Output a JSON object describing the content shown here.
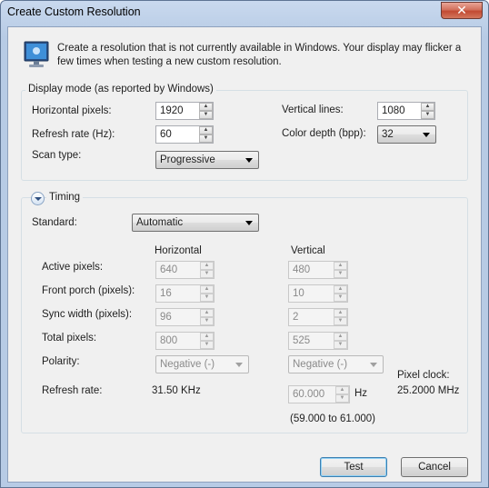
{
  "window": {
    "title": "Create Custom Resolution",
    "close_glyph": "✕"
  },
  "intro": {
    "icon": "monitor-icon",
    "text": "Create a resolution that is not currently available in Windows. Your display may flicker a few times when testing a new custom resolution."
  },
  "display_mode": {
    "legend": "Display mode (as reported by Windows)",
    "horizontal_pixels": {
      "label": "Horizontal pixels:",
      "value": "1920"
    },
    "vertical_lines": {
      "label": "Vertical lines:",
      "value": "1080"
    },
    "refresh_rate": {
      "label": "Refresh rate (Hz):",
      "value": "60"
    },
    "color_depth": {
      "label": "Color depth (bpp):",
      "value": "32"
    },
    "scan_type": {
      "label": "Scan type:",
      "value": "Progressive"
    }
  },
  "timing": {
    "legend": "Timing",
    "standard": {
      "label": "Standard:",
      "value": "Automatic"
    },
    "col_horizontal": "Horizontal",
    "col_vertical": "Vertical",
    "rows": [
      {
        "label": "Active pixels:",
        "h": "640",
        "v": "480"
      },
      {
        "label": "Front porch (pixels):",
        "h": "16",
        "v": "10"
      },
      {
        "label": "Sync width (pixels):",
        "h": "96",
        "v": "2"
      },
      {
        "label": "Total pixels:",
        "h": "800",
        "v": "525"
      }
    ],
    "polarity": {
      "label": "Polarity:",
      "h": "Negative (-)",
      "v": "Negative (-)"
    },
    "refresh": {
      "label": "Refresh rate:",
      "h_value": "31.50 KHz",
      "v_value": "60.000",
      "v_unit": "Hz",
      "range": "(59.000 to 61.000)"
    },
    "pixel_clock": {
      "label": "Pixel clock:",
      "value": "25.2000 MHz"
    }
  },
  "buttons": {
    "test": "Test",
    "cancel": "Cancel"
  },
  "spinner_glyphs": {
    "up": "▲",
    "down": "▼"
  }
}
